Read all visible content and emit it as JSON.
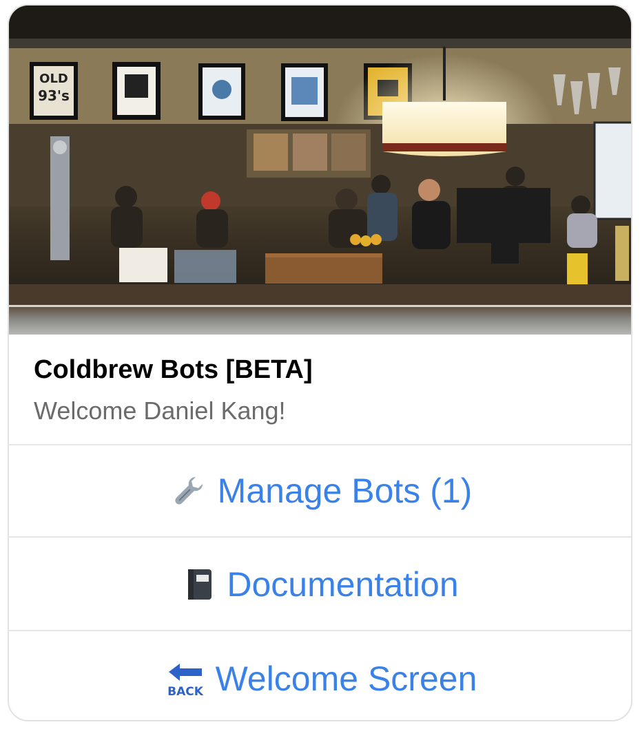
{
  "card": {
    "title": "Coldbrew Bots [BETA]",
    "subtitle": "Welcome Daniel Kang!"
  },
  "buttons": [
    {
      "label": "Manage Bots (1)",
      "icon": "wrench-icon"
    },
    {
      "label": "Documentation",
      "icon": "notebook-icon"
    },
    {
      "label": "Welcome Screen",
      "icon": "back-arrow-icon"
    }
  ],
  "hero_image": {
    "description_icon": "coffee-bar-photo",
    "poster_text": [
      "OLD",
      "93's"
    ],
    "back_icon_text": "BACK"
  },
  "colors": {
    "link": "#3b82e8",
    "title": "#000000",
    "subtitle": "#6b6b6b",
    "divider": "#e6e6e6"
  }
}
